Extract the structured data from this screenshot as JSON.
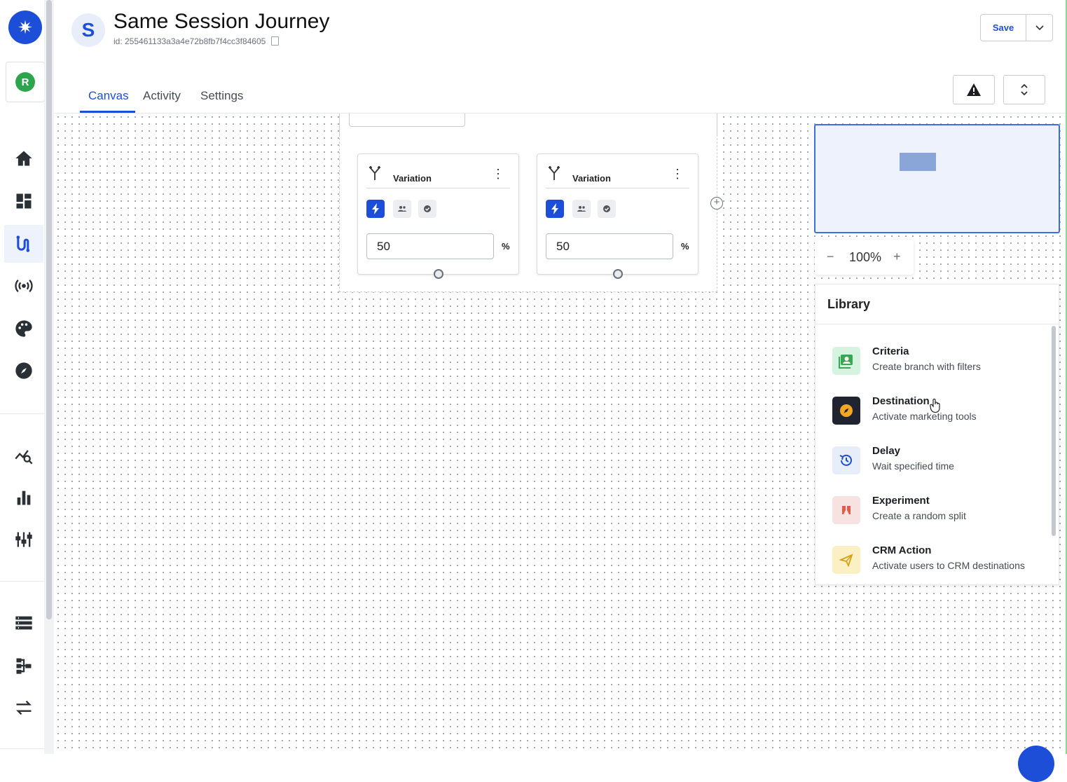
{
  "journey": {
    "avatar_letter": "S",
    "title": "Same Session Journey",
    "id_text": "id: 255461133a3a4e72b8fb7f4cc3f84605"
  },
  "header": {
    "save_label": "Save"
  },
  "workspace": {
    "initial": "R"
  },
  "tabs": [
    {
      "label": "Canvas",
      "active": true
    },
    {
      "label": "Activity",
      "active": false
    },
    {
      "label": "Settings",
      "active": false
    }
  ],
  "nav": {
    "items": [
      {
        "icon": "home-icon"
      },
      {
        "icon": "dashboard-icon"
      },
      {
        "icon": "journeys-icon",
        "active": true
      },
      {
        "icon": "broadcast-icon"
      },
      {
        "icon": "palette-icon"
      },
      {
        "icon": "compass-icon"
      },
      {
        "icon": "analytics-search-icon"
      },
      {
        "icon": "bar-chart-icon"
      },
      {
        "icon": "tune-icon"
      },
      {
        "icon": "list-icon"
      },
      {
        "icon": "hierarchy-icon"
      },
      {
        "icon": "sync-arrows-icon"
      }
    ]
  },
  "canvas": {
    "variations": [
      {
        "title": "Variation",
        "percent": "50",
        "unit": "%"
      },
      {
        "title": "Variation",
        "percent": "50",
        "unit": "%"
      }
    ]
  },
  "zoom": {
    "level": "100%",
    "minus": "−",
    "plus": "+"
  },
  "library": {
    "title": "Library",
    "items": [
      {
        "name": "Criteria",
        "description": "Create branch with filters",
        "icon": "criteria-icon",
        "icon_bg": "#d6f3df"
      },
      {
        "name": "Destination",
        "description": "Activate marketing tools",
        "icon": "destination-icon",
        "icon_bg": "#1f2430"
      },
      {
        "name": "Delay",
        "description": "Wait specified time",
        "icon": "delay-icon",
        "icon_bg": "#e8edfa"
      },
      {
        "name": "Experiment",
        "description": "Create a random split",
        "icon": "experiment-icon",
        "icon_bg": "#f6e3e1"
      },
      {
        "name": "CRM Action",
        "description": "Activate users to CRM destinations",
        "icon": "crm-icon",
        "icon_bg": "#fbf0c3"
      }
    ]
  },
  "colors": {
    "accent": "#1d4ed8",
    "canvas_dot": "#9da3ab",
    "minimap_border": "#3b6fe0"
  }
}
